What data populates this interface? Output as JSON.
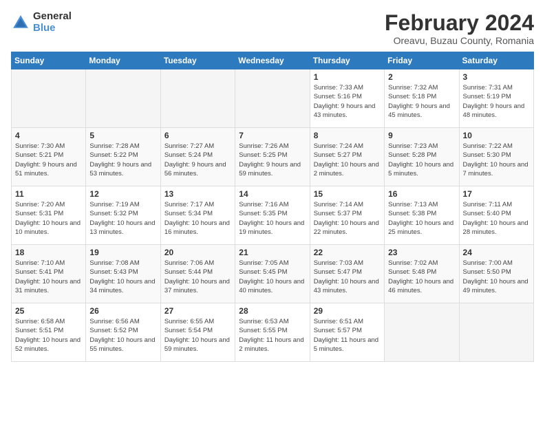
{
  "header": {
    "logo_general": "General",
    "logo_blue": "Blue",
    "month_title": "February 2024",
    "location": "Oreavu, Buzau County, Romania"
  },
  "weekdays": [
    "Sunday",
    "Monday",
    "Tuesday",
    "Wednesday",
    "Thursday",
    "Friday",
    "Saturday"
  ],
  "weeks": [
    [
      {
        "day": "",
        "info": ""
      },
      {
        "day": "",
        "info": ""
      },
      {
        "day": "",
        "info": ""
      },
      {
        "day": "",
        "info": ""
      },
      {
        "day": "1",
        "sunrise": "Sunrise: 7:33 AM",
        "sunset": "Sunset: 5:16 PM",
        "daylight": "Daylight: 9 hours and 43 minutes."
      },
      {
        "day": "2",
        "sunrise": "Sunrise: 7:32 AM",
        "sunset": "Sunset: 5:18 PM",
        "daylight": "Daylight: 9 hours and 45 minutes."
      },
      {
        "day": "3",
        "sunrise": "Sunrise: 7:31 AM",
        "sunset": "Sunset: 5:19 PM",
        "daylight": "Daylight: 9 hours and 48 minutes."
      }
    ],
    [
      {
        "day": "4",
        "sunrise": "Sunrise: 7:30 AM",
        "sunset": "Sunset: 5:21 PM",
        "daylight": "Daylight: 9 hours and 51 minutes."
      },
      {
        "day": "5",
        "sunrise": "Sunrise: 7:28 AM",
        "sunset": "Sunset: 5:22 PM",
        "daylight": "Daylight: 9 hours and 53 minutes."
      },
      {
        "day": "6",
        "sunrise": "Sunrise: 7:27 AM",
        "sunset": "Sunset: 5:24 PM",
        "daylight": "Daylight: 9 hours and 56 minutes."
      },
      {
        "day": "7",
        "sunrise": "Sunrise: 7:26 AM",
        "sunset": "Sunset: 5:25 PM",
        "daylight": "Daylight: 9 hours and 59 minutes."
      },
      {
        "day": "8",
        "sunrise": "Sunrise: 7:24 AM",
        "sunset": "Sunset: 5:27 PM",
        "daylight": "Daylight: 10 hours and 2 minutes."
      },
      {
        "day": "9",
        "sunrise": "Sunrise: 7:23 AM",
        "sunset": "Sunset: 5:28 PM",
        "daylight": "Daylight: 10 hours and 5 minutes."
      },
      {
        "day": "10",
        "sunrise": "Sunrise: 7:22 AM",
        "sunset": "Sunset: 5:30 PM",
        "daylight": "Daylight: 10 hours and 7 minutes."
      }
    ],
    [
      {
        "day": "11",
        "sunrise": "Sunrise: 7:20 AM",
        "sunset": "Sunset: 5:31 PM",
        "daylight": "Daylight: 10 hours and 10 minutes."
      },
      {
        "day": "12",
        "sunrise": "Sunrise: 7:19 AM",
        "sunset": "Sunset: 5:32 PM",
        "daylight": "Daylight: 10 hours and 13 minutes."
      },
      {
        "day": "13",
        "sunrise": "Sunrise: 7:17 AM",
        "sunset": "Sunset: 5:34 PM",
        "daylight": "Daylight: 10 hours and 16 minutes."
      },
      {
        "day": "14",
        "sunrise": "Sunrise: 7:16 AM",
        "sunset": "Sunset: 5:35 PM",
        "daylight": "Daylight: 10 hours and 19 minutes."
      },
      {
        "day": "15",
        "sunrise": "Sunrise: 7:14 AM",
        "sunset": "Sunset: 5:37 PM",
        "daylight": "Daylight: 10 hours and 22 minutes."
      },
      {
        "day": "16",
        "sunrise": "Sunrise: 7:13 AM",
        "sunset": "Sunset: 5:38 PM",
        "daylight": "Daylight: 10 hours and 25 minutes."
      },
      {
        "day": "17",
        "sunrise": "Sunrise: 7:11 AM",
        "sunset": "Sunset: 5:40 PM",
        "daylight": "Daylight: 10 hours and 28 minutes."
      }
    ],
    [
      {
        "day": "18",
        "sunrise": "Sunrise: 7:10 AM",
        "sunset": "Sunset: 5:41 PM",
        "daylight": "Daylight: 10 hours and 31 minutes."
      },
      {
        "day": "19",
        "sunrise": "Sunrise: 7:08 AM",
        "sunset": "Sunset: 5:43 PM",
        "daylight": "Daylight: 10 hours and 34 minutes."
      },
      {
        "day": "20",
        "sunrise": "Sunrise: 7:06 AM",
        "sunset": "Sunset: 5:44 PM",
        "daylight": "Daylight: 10 hours and 37 minutes."
      },
      {
        "day": "21",
        "sunrise": "Sunrise: 7:05 AM",
        "sunset": "Sunset: 5:45 PM",
        "daylight": "Daylight: 10 hours and 40 minutes."
      },
      {
        "day": "22",
        "sunrise": "Sunrise: 7:03 AM",
        "sunset": "Sunset: 5:47 PM",
        "daylight": "Daylight: 10 hours and 43 minutes."
      },
      {
        "day": "23",
        "sunrise": "Sunrise: 7:02 AM",
        "sunset": "Sunset: 5:48 PM",
        "daylight": "Daylight: 10 hours and 46 minutes."
      },
      {
        "day": "24",
        "sunrise": "Sunrise: 7:00 AM",
        "sunset": "Sunset: 5:50 PM",
        "daylight": "Daylight: 10 hours and 49 minutes."
      }
    ],
    [
      {
        "day": "25",
        "sunrise": "Sunrise: 6:58 AM",
        "sunset": "Sunset: 5:51 PM",
        "daylight": "Daylight: 10 hours and 52 minutes."
      },
      {
        "day": "26",
        "sunrise": "Sunrise: 6:56 AM",
        "sunset": "Sunset: 5:52 PM",
        "daylight": "Daylight: 10 hours and 55 minutes."
      },
      {
        "day": "27",
        "sunrise": "Sunrise: 6:55 AM",
        "sunset": "Sunset: 5:54 PM",
        "daylight": "Daylight: 10 hours and 59 minutes."
      },
      {
        "day": "28",
        "sunrise": "Sunrise: 6:53 AM",
        "sunset": "Sunset: 5:55 PM",
        "daylight": "Daylight: 11 hours and 2 minutes."
      },
      {
        "day": "29",
        "sunrise": "Sunrise: 6:51 AM",
        "sunset": "Sunset: 5:57 PM",
        "daylight": "Daylight: 11 hours and 5 minutes."
      },
      {
        "day": "",
        "info": ""
      },
      {
        "day": "",
        "info": ""
      }
    ]
  ]
}
